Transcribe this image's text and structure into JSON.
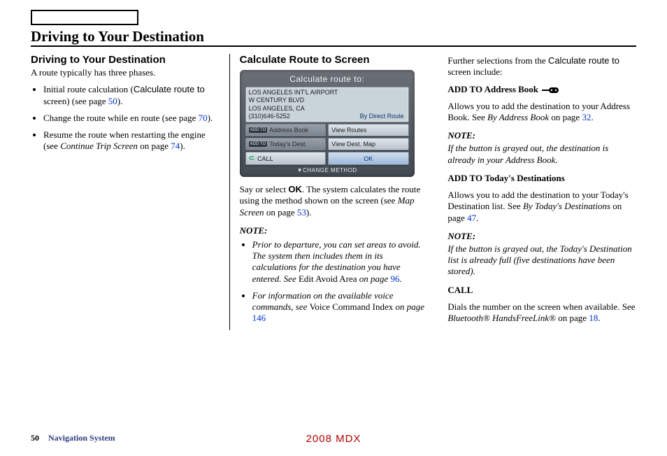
{
  "header": {
    "section_title": "Driving to Your Destination"
  },
  "col1": {
    "heading": "Driving to Your Destination",
    "intro": "A route typically has three phases.",
    "b1_a": "Initial route calculation (",
    "b1_b": "Calculate route to",
    "b1_c": " screen) (see page ",
    "b1_page": "50",
    "b1_d": ").",
    "b2_a": "Change the route while en route (see page ",
    "b2_page": "70",
    "b2_b": ").",
    "b3_a": "Resume the route when restarting the engine (see ",
    "b3_b": "Continue Trip Screen",
    "b3_c": " on page ",
    "b3_page": "74",
    "b3_d": ")."
  },
  "col2": {
    "heading": "Calculate Route to Screen",
    "screen": {
      "title": "Calculate route to:",
      "line1": "LOS ANGELES INT'L AIRPORT",
      "line2": "W CENTURY BLVD",
      "line3": "LOS ANGELES, CA",
      "phone": "(310)646-5252",
      "method": "By Direct Route",
      "addto": "ADD TO",
      "btn_ab": "Address Book",
      "btn_vr": "View Routes",
      "btn_td": "Today's Dest.",
      "btn_vdm": "View Dest. Map",
      "btn_call": "CALL",
      "btn_ok": "OK",
      "footer": "▼CHANGE METHOD"
    },
    "p1_a": "Say or select ",
    "p1_b": "OK",
    "p1_c": ". The system calculates the route using the method shown on the screen (see ",
    "p1_d": "Map Screen",
    "p1_e": " on page ",
    "p1_page": "53",
    "p1_f": ").",
    "note_label": "NOTE:",
    "n1_a": "Prior to departure, you can set areas to avoid. The system then includes them in its calculations for the destination you have entered. See ",
    "n1_b": "Edit Avoid Area",
    "n1_c": " on page ",
    "n1_page": "96",
    "n1_d": ".",
    "n2_a": "For information on the available voice commands, see ",
    "n2_b": "Voice Command Index",
    "n2_c": " on page ",
    "n2_page": "146"
  },
  "col3": {
    "intro_a": "Further selections from the ",
    "intro_b": "Calculate route to",
    "intro_c": " screen include:",
    "h1": "ADD TO Address Book",
    "p1_a": "Allows you to add the destination to your Address Book. See ",
    "p1_b": "By Address Book",
    "p1_c": " on page ",
    "p1_page": "32",
    "p1_d": ".",
    "note_label": "NOTE:",
    "note1": "If the button is grayed out, the destination is already in your Address Book.",
    "h2": "ADD TO Today's Destinations",
    "p2_a": "Allows you to add the destination to your Today's Destination list. See ",
    "p2_b": "By Today's Destinations",
    "p2_c": " on page ",
    "p2_page": "47",
    "p2_d": ".",
    "note2": "If the button is grayed out, the Today's Destination list is already full (five destinations have been stored).",
    "h3": "CALL",
    "p3_a": "Dials the number on the screen when available. See ",
    "p3_b": "Bluetooth® HandsFreeLink®",
    "p3_c": " on page ",
    "p3_page": "18",
    "p3_d": "."
  },
  "footer": {
    "page_num": "50",
    "label": "Navigation System",
    "model": "2008  MDX"
  }
}
